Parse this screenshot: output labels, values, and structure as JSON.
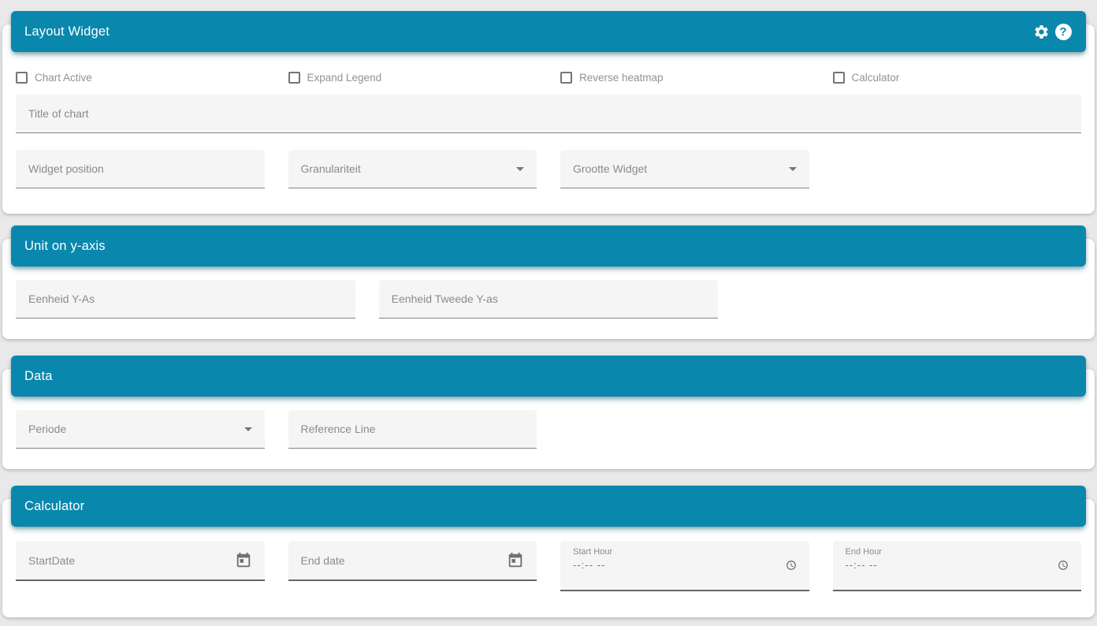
{
  "colors": {
    "accent": "#0a87ac",
    "page_bg": "#e9e9eb",
    "card_bg": "#ffffff",
    "field_bg": "#f5f5f5",
    "field_border": "#828282",
    "muted_text": "#8a8a8a"
  },
  "panels": {
    "layout_widget": {
      "title": "Layout Widget",
      "header_icons": [
        {
          "name": "settings-icon",
          "glyph": "gear"
        },
        {
          "name": "help-icon",
          "glyph": "question-mark-circle"
        }
      ],
      "checkboxes": [
        {
          "label": "Chart Active",
          "checked": false
        },
        {
          "label": "Expand Legend",
          "checked": false
        },
        {
          "label": "Reverse heatmap",
          "checked": false
        },
        {
          "label": "Calculator",
          "checked": false
        }
      ],
      "title_field": {
        "placeholder": "Title of chart",
        "value": ""
      },
      "widget_position": {
        "placeholder": "Widget position",
        "value": ""
      },
      "granularity_select": {
        "label": "Granulariteit",
        "selected_value": ""
      },
      "size_select": {
        "label": "Grootte Widget",
        "selected_value": ""
      }
    },
    "unit_y_axis": {
      "title": "Unit on y-axis",
      "unit_y": {
        "placeholder": "Eenheid Y-As",
        "value": ""
      },
      "unit_second_y": {
        "placeholder": "Eenheid Tweede Y-as",
        "value": ""
      }
    },
    "data": {
      "title": "Data",
      "period_select": {
        "label": "Periode",
        "selected_value": ""
      },
      "reference_line": {
        "placeholder": "Reference Line",
        "value": ""
      }
    },
    "calculator": {
      "title": "Calculator",
      "start_date": {
        "placeholder": "StartDate",
        "value": "",
        "icon": "calendar-icon"
      },
      "end_date": {
        "placeholder": "End date",
        "value": "",
        "icon": "calendar-icon"
      },
      "start_hour": {
        "label": "Start Hour",
        "value": "--:-- --",
        "icon": "clock-icon"
      },
      "end_hour": {
        "label": "End Hour",
        "value": "--:-- --",
        "icon": "clock-icon"
      }
    }
  }
}
